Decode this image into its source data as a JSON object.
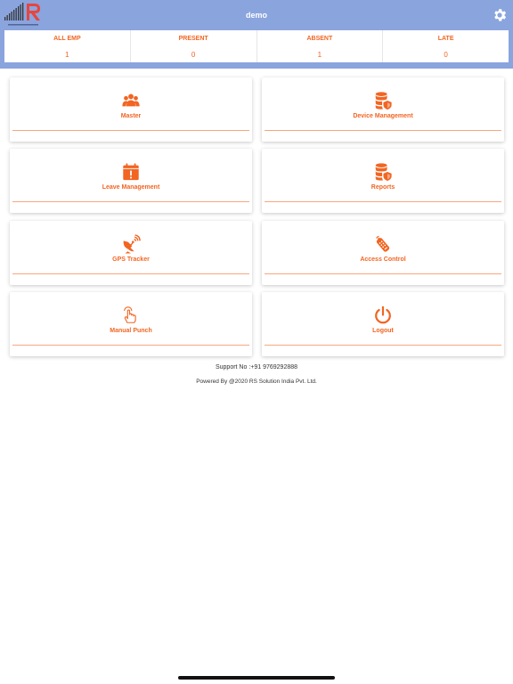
{
  "header": {
    "title": "demo",
    "settings_icon": "gear-icon",
    "logo_icon": "rs-solution-logo"
  },
  "stats": [
    {
      "label": "ALL EMP",
      "value": "1"
    },
    {
      "label": "PRESENT",
      "value": "0"
    },
    {
      "label": "ABSENT",
      "value": "1"
    },
    {
      "label": "LATE",
      "value": "0"
    }
  ],
  "menu": [
    {
      "label": "Master",
      "icon": "group-icon"
    },
    {
      "label": "Device Management",
      "icon": "database-shield-icon"
    },
    {
      "label": "Leave Management",
      "icon": "calendar-alert-icon"
    },
    {
      "label": "Reports",
      "icon": "database-shield-icon"
    },
    {
      "label": "GPS Tracker",
      "icon": "satellite-dish-icon"
    },
    {
      "label": "Access Control",
      "icon": "remote-control-icon"
    },
    {
      "label": "Manual Punch",
      "icon": "tap-hand-icon"
    },
    {
      "label": "Logout",
      "icon": "power-icon"
    }
  ],
  "footer": {
    "support": "Support No :+91 9769292888",
    "powered": "Powered By @2020 RS Solution India Pvt. Ltd."
  },
  "colors": {
    "accent": "#f26522",
    "header_bg": "#8aa4de",
    "divider": "#f7a77f"
  }
}
